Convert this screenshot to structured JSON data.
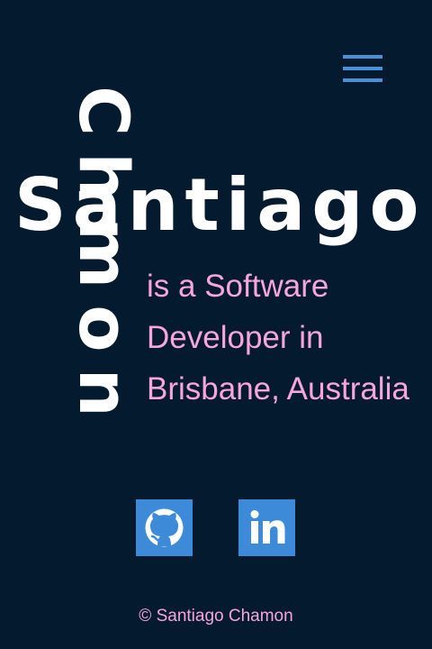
{
  "header": {
    "menu_icon": "hamburger-menu-icon"
  },
  "hero": {
    "first_name": "Santiago",
    "last_name": "Chmon",
    "tagline": "is a Software Developer in Brisbane, Australia"
  },
  "social": {
    "links": [
      {
        "icon": "github-icon"
      },
      {
        "icon": "linkedin-icon"
      }
    ]
  },
  "footer": {
    "copyright": "© Santiago Chamon"
  },
  "colors": {
    "background": "#041a2e",
    "accent_blue": "#4a90d9",
    "pink": "#f7a5df",
    "white": "#ffffff"
  }
}
